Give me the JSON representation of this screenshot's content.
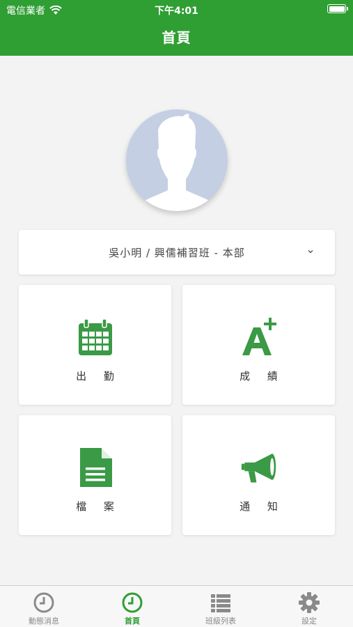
{
  "status_bar": {
    "carrier": "電信業者",
    "time": "下午4:01",
    "wifi_icon": "wifi-icon",
    "battery_icon": "battery-icon"
  },
  "header": {
    "title": "首頁"
  },
  "profile": {
    "avatar_icon": "person-silhouette-icon",
    "selector_text": "吳小明 / 興儒補習班 - 本部",
    "chevron_icon": "chevron-down-icon"
  },
  "cards": [
    {
      "label": "出 勤",
      "icon": "calendar-icon"
    },
    {
      "label": "成 績",
      "icon": "grade-a-plus-icon"
    },
    {
      "label": "檔 案",
      "icon": "document-icon"
    },
    {
      "label": "通 知",
      "icon": "megaphone-icon"
    }
  ],
  "tabs": [
    {
      "label": "動態消息",
      "icon": "clock-icon",
      "active": false
    },
    {
      "label": "首頁",
      "icon": "clock-icon",
      "active": true
    },
    {
      "label": "班級列表",
      "icon": "list-icon",
      "active": false
    },
    {
      "label": "設定",
      "icon": "gear-icon",
      "active": false
    }
  ],
  "colors": {
    "primary": "#2f9e33",
    "icon_green": "#3a9a45",
    "background": "#f3f3f3",
    "avatar_bg": "#c5cfe3",
    "tab_inactive": "#888888"
  }
}
